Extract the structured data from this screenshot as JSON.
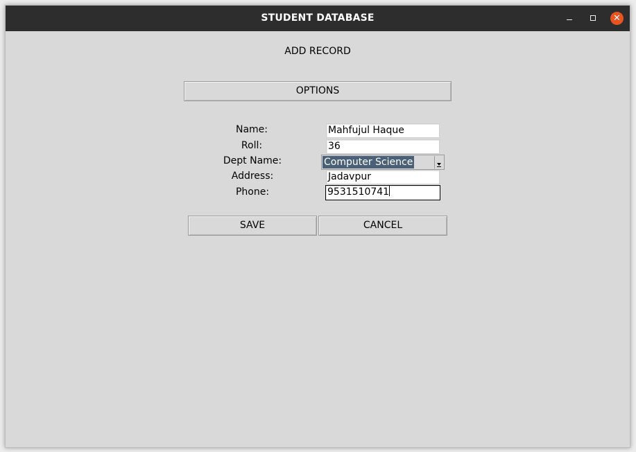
{
  "window": {
    "title": "STUDENT DATABASE",
    "controls": {
      "minimize": "minimize-icon",
      "maximize": "maximize-icon",
      "close": "close-icon"
    },
    "close_color": "#e95420"
  },
  "form": {
    "heading": "ADD RECORD",
    "options_label": "OPTIONS",
    "fields": {
      "name": {
        "label": "Name:",
        "value": "Mahfujul Haque"
      },
      "roll": {
        "label": "Roll:",
        "value": "36"
      },
      "dept": {
        "label": "Dept Name:",
        "value": "Computer Science"
      },
      "address": {
        "label": "Address:",
        "value": "Jadavpur"
      },
      "phone": {
        "label": "Phone:",
        "value": "9531510741"
      }
    },
    "save_label": "SAVE",
    "cancel_label": "CANCEL"
  },
  "colors": {
    "background": "#d9d9d9",
    "titlebar": "#2d2d2d",
    "selection": "#4a6078"
  }
}
